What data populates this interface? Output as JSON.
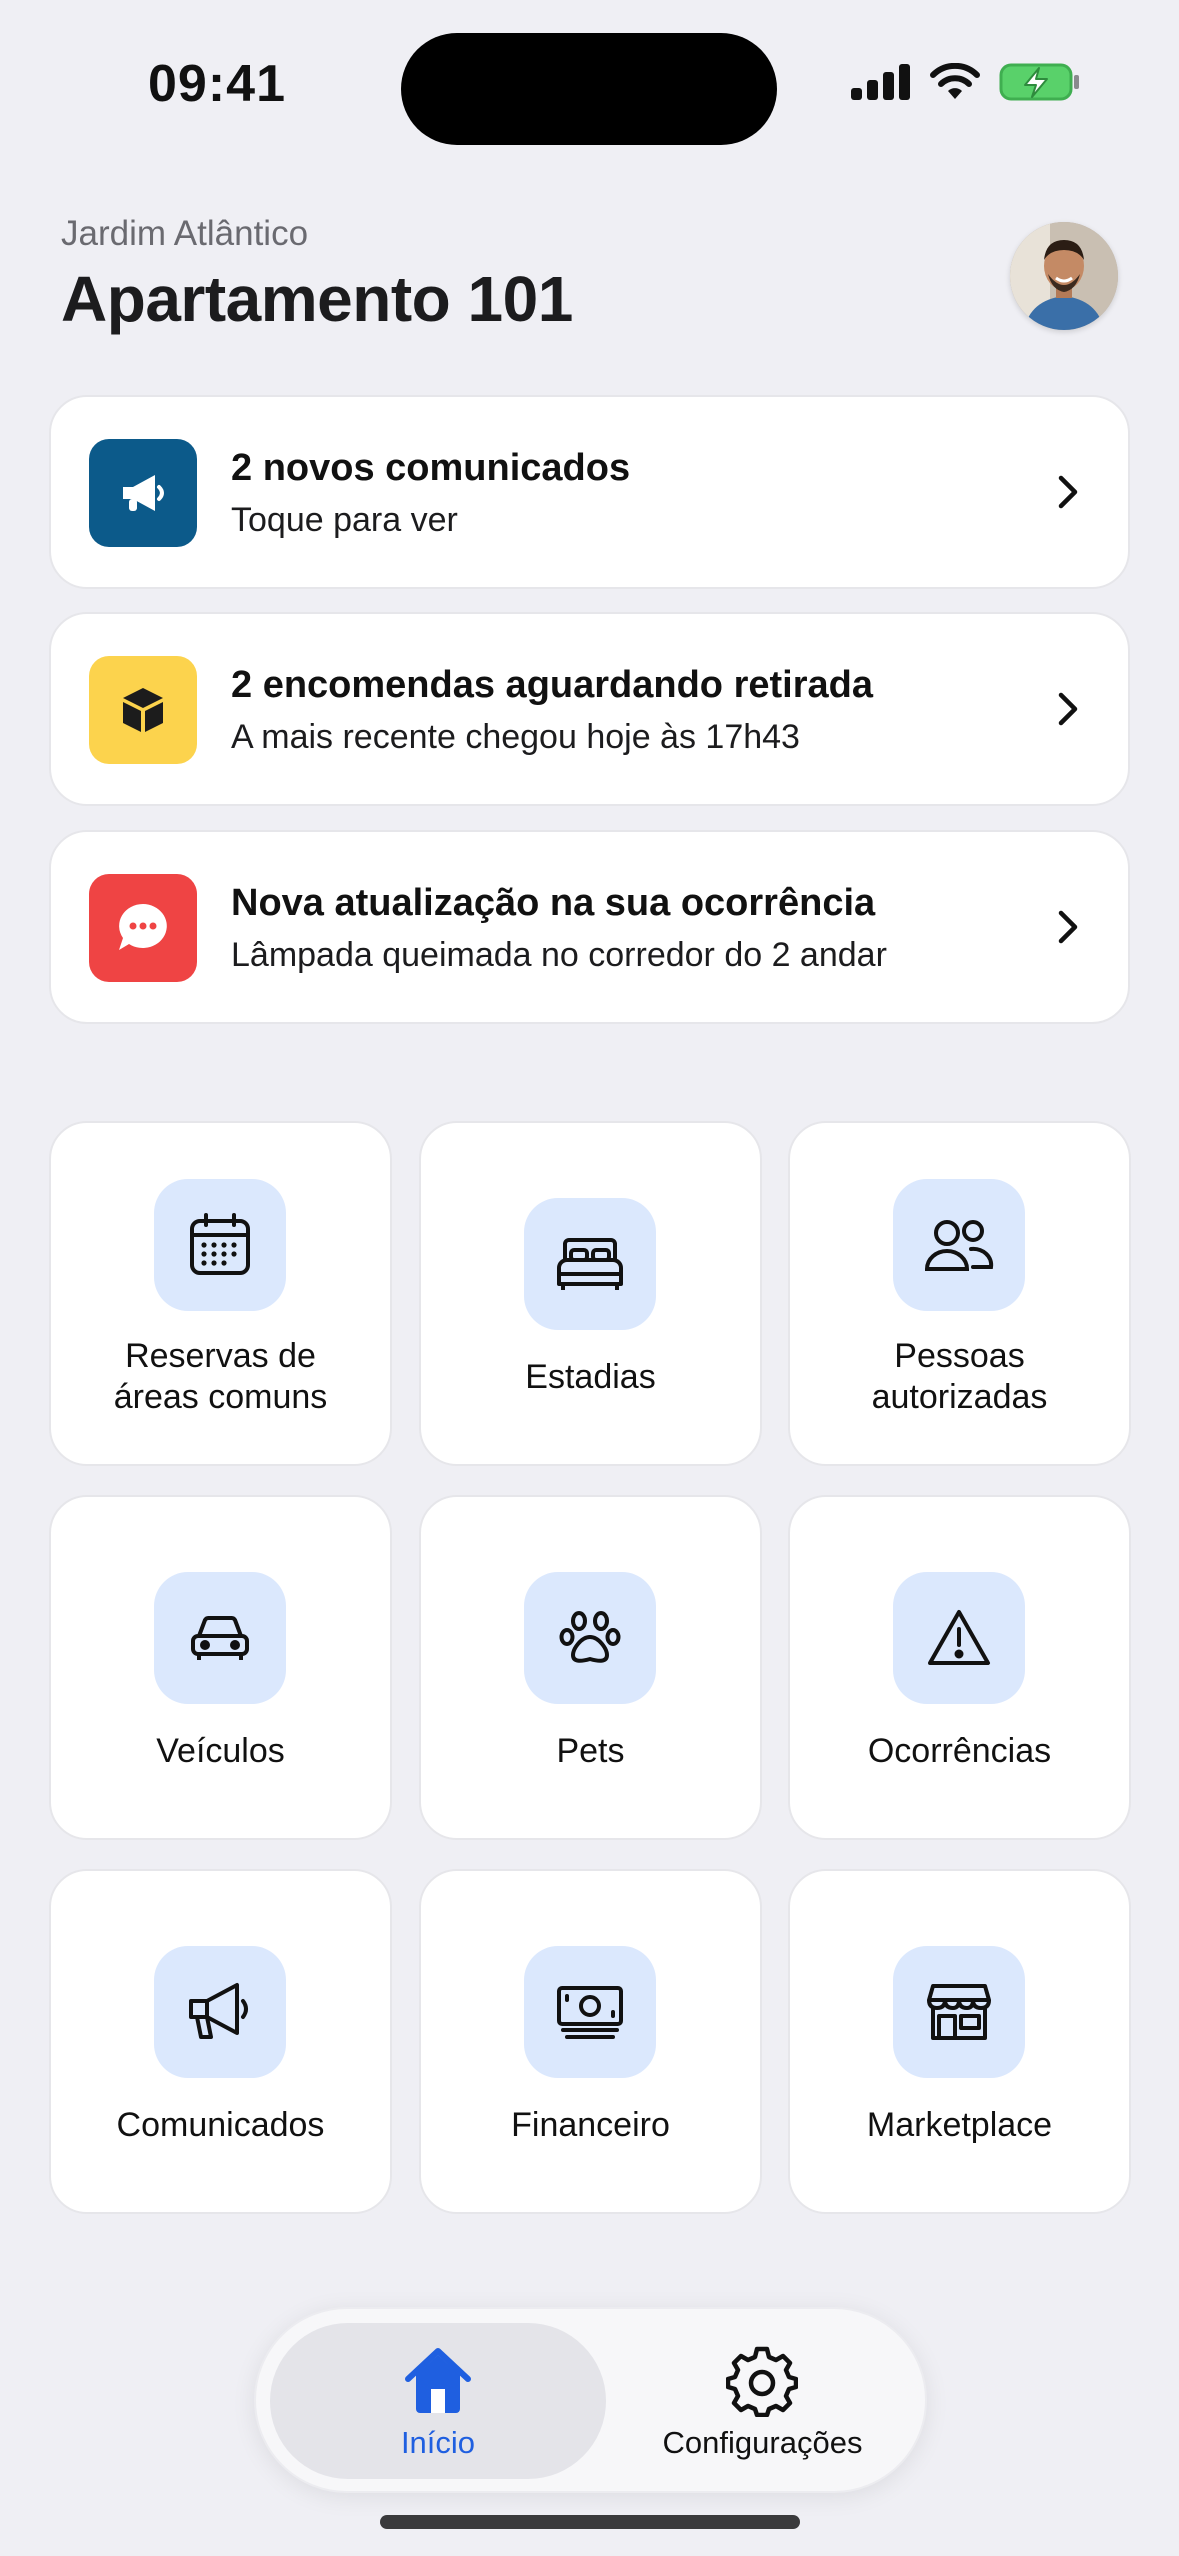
{
  "status_bar": {
    "time": "09:41"
  },
  "header": {
    "condo_name": "Jardim Atlântico",
    "unit_title": "Apartamento 101"
  },
  "notifications": [
    {
      "title": "2 novos comunicados",
      "subtitle": "Toque para ver",
      "icon": "megaphone-icon",
      "color": "#0c5a8a"
    },
    {
      "title": "2 encomendas aguardando retirada",
      "subtitle": "A mais recente chegou hoje às 17h43",
      "icon": "package-icon",
      "color": "#fcd34d"
    },
    {
      "title": "Nova atualização na sua ocorrência",
      "subtitle": "Lâmpada queimada no corredor do 2 andar",
      "icon": "chat-bubble-icon",
      "color": "#ef4444"
    }
  ],
  "tiles": [
    {
      "label_line1": "Reservas de",
      "label_line2": "áreas comuns",
      "icon": "calendar-icon"
    },
    {
      "label": "Estadias",
      "icon": "bed-icon"
    },
    {
      "label_line1": "Pessoas",
      "label_line2": "autorizadas",
      "icon": "people-icon"
    },
    {
      "label": "Veículos",
      "icon": "car-icon"
    },
    {
      "label": "Pets",
      "icon": "paw-icon"
    },
    {
      "label": "Ocorrências",
      "icon": "warning-icon"
    },
    {
      "label": "Comunicados",
      "icon": "megaphone-icon"
    },
    {
      "label": "Financeiro",
      "icon": "money-icon"
    },
    {
      "label": "Marketplace",
      "icon": "storefront-icon"
    }
  ],
  "tab_bar": {
    "home_label": "Início",
    "settings_label": "Configurações",
    "active_color": "#1f5fe0"
  }
}
